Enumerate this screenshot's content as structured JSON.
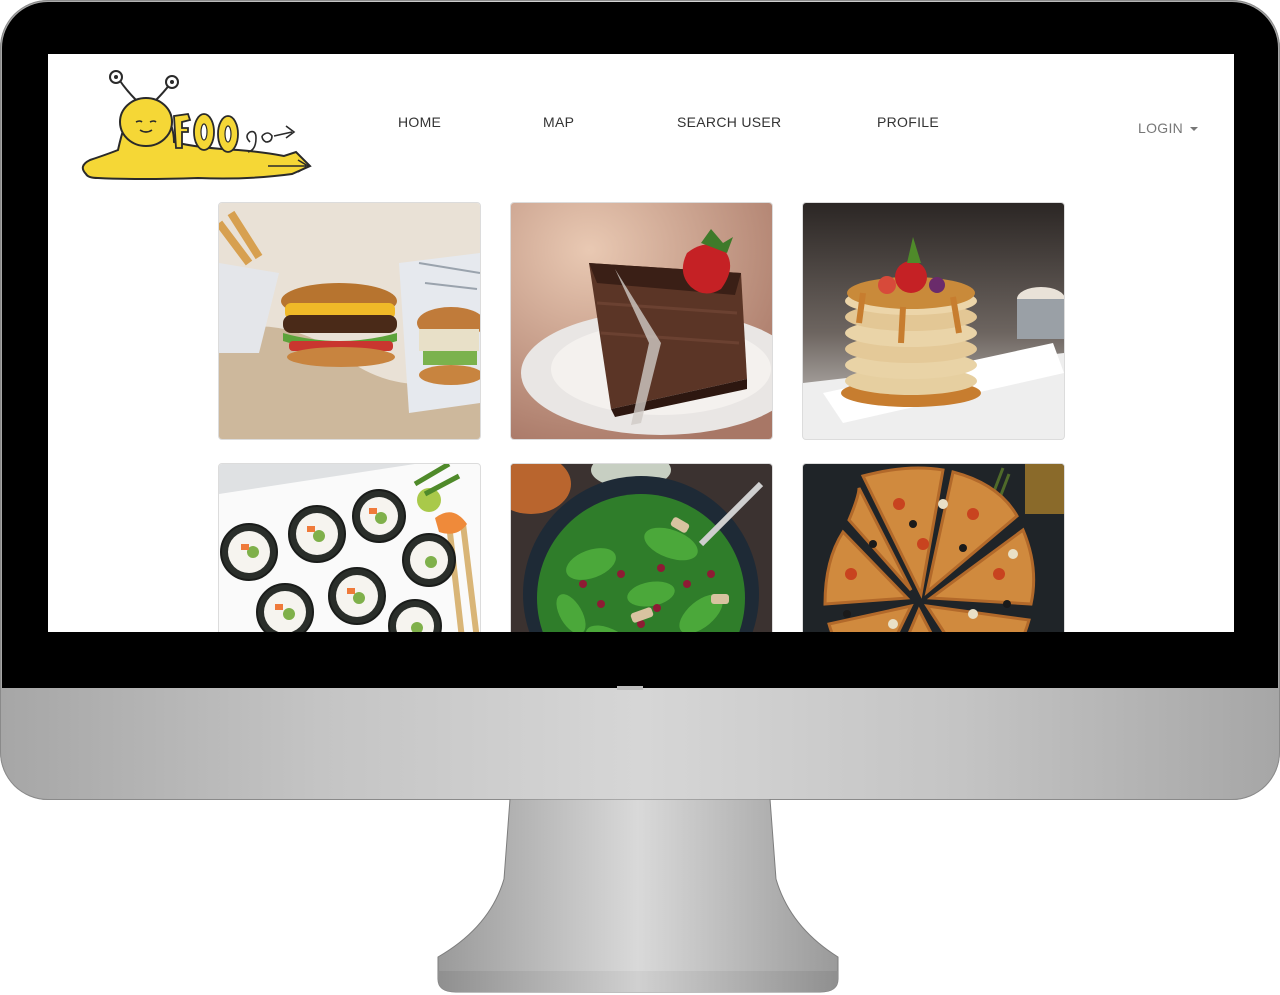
{
  "app": {
    "logo_text": "FOO go"
  },
  "nav": {
    "items": [
      {
        "label": "HOME"
      },
      {
        "label": "MAP"
      },
      {
        "label": "SEARCH USER"
      },
      {
        "label": "PROFILE"
      }
    ],
    "login_label": "LOGIN"
  },
  "gallery": {
    "items": [
      {
        "subject": "burgers",
        "icon": "burger-photo"
      },
      {
        "subject": "chocolate-cake",
        "icon": "cake-photo"
      },
      {
        "subject": "pancakes",
        "icon": "pancakes-photo"
      },
      {
        "subject": "sushi",
        "icon": "sushi-photo"
      },
      {
        "subject": "salad",
        "icon": "salad-photo"
      },
      {
        "subject": "pizza",
        "icon": "pizza-photo"
      }
    ]
  },
  "colors": {
    "logo_yellow": "#f5d736",
    "nav_text": "#333333",
    "login_text": "#777777",
    "bezel": "#000000"
  }
}
